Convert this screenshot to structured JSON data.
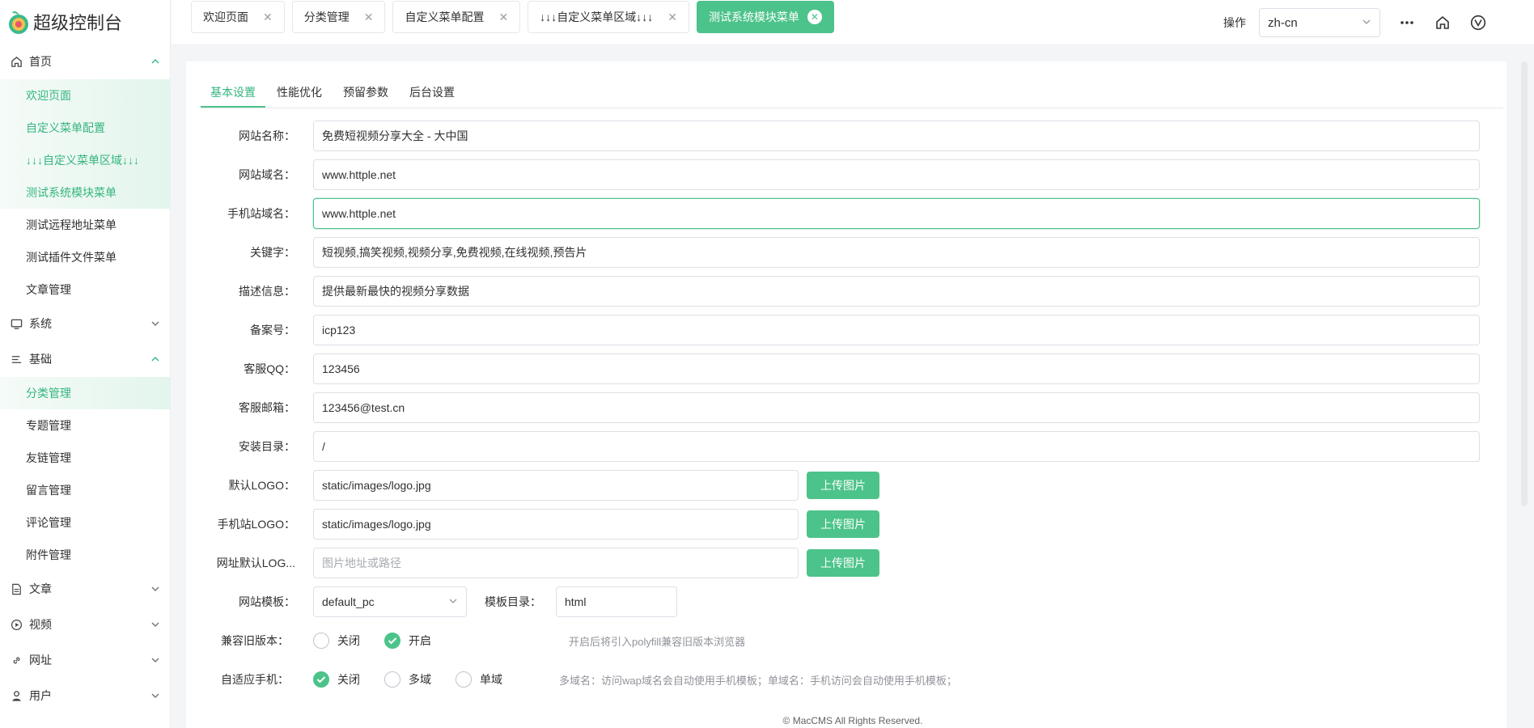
{
  "app": {
    "title": "超级控制台"
  },
  "sidebar": {
    "groups": [
      {
        "label": "首页",
        "icon": "home-icon",
        "open": true,
        "items": [
          {
            "label": "欢迎页面",
            "active": true
          },
          {
            "label": "自定义菜单配置",
            "active": true
          },
          {
            "label": "↓↓↓自定义菜单区域↓↓↓",
            "active": true
          },
          {
            "label": "测试系统模块菜单",
            "active": true
          },
          {
            "label": "测试远程地址菜单",
            "active": false
          },
          {
            "label": "测试插件文件菜单",
            "active": false
          },
          {
            "label": "文章管理",
            "active": false
          }
        ]
      },
      {
        "label": "系统",
        "icon": "monitor-icon",
        "open": false,
        "items": []
      },
      {
        "label": "基础",
        "icon": "list-icon",
        "open": true,
        "items": [
          {
            "label": "分类管理",
            "active": true
          },
          {
            "label": "专题管理",
            "active": false
          },
          {
            "label": "友链管理",
            "active": false
          },
          {
            "label": "留言管理",
            "active": false
          },
          {
            "label": "评论管理",
            "active": false
          },
          {
            "label": "附件管理",
            "active": false
          }
        ]
      },
      {
        "label": "文章",
        "icon": "document-icon",
        "open": false,
        "items": []
      },
      {
        "label": "视频",
        "icon": "play-icon",
        "open": false,
        "items": []
      },
      {
        "label": "网址",
        "icon": "link-icon",
        "open": false,
        "items": []
      },
      {
        "label": "用户",
        "icon": "user-icon",
        "open": false,
        "items": []
      }
    ]
  },
  "tabs": [
    {
      "label": "欢迎页面",
      "active": false
    },
    {
      "label": "分类管理",
      "active": false
    },
    {
      "label": "自定义菜单配置",
      "active": false
    },
    {
      "label": "↓↓↓自定义菜单区域↓↓↓",
      "active": false
    },
    {
      "label": "测试系统模块菜单",
      "active": true
    }
  ],
  "header": {
    "op_label": "操作",
    "lang": "zh-cn"
  },
  "subtabs": [
    "基本设置",
    "性能优化",
    "预留参数",
    "后台设置"
  ],
  "form": {
    "site_name": {
      "label": "网站名称：",
      "value": "免费短视频分享大全 - 大中国"
    },
    "site_domain": {
      "label": "网站域名：",
      "value": "www.httple.net"
    },
    "mobile_domain": {
      "label": "手机站域名：",
      "value": "www.httple.net"
    },
    "keywords": {
      "label": "关键字：",
      "value": "短视频,搞笑视频,视频分享,免费视频,在线视频,预告片"
    },
    "description": {
      "label": "描述信息：",
      "value": "提供最新最快的视频分享数据"
    },
    "icp": {
      "label": "备案号：",
      "value": "icp123"
    },
    "qq": {
      "label": "客服QQ：",
      "value": "123456"
    },
    "email": {
      "label": "客服邮箱：",
      "value": "123456@test.cn"
    },
    "install_dir": {
      "label": "安装目录：",
      "value": "/"
    },
    "logo": {
      "label": "默认LOGO：",
      "value": "static/images/logo.jpg",
      "button": "上传图片"
    },
    "mobile_logo": {
      "label": "手机站LOGO：",
      "value": "static/images/logo.jpg",
      "button": "上传图片"
    },
    "url_logo": {
      "label": "网址默认LOG...",
      "placeholder": "图片地址或路径",
      "button": "上传图片"
    },
    "template": {
      "label": "网站模板：",
      "value": "default_pc"
    },
    "template_dir": {
      "label": "模板目录：",
      "value": "html"
    },
    "compat": {
      "label": "兼容旧版本：",
      "options": [
        "关闭",
        "开启"
      ],
      "selected": 1,
      "hint": "开启后将引入polyfill兼容旧版本浏览器"
    },
    "adaptive": {
      "label": "自适应手机：",
      "options": [
        "关闭",
        "多域",
        "单域"
      ],
      "selected": 0,
      "hint": "多域名：访问wap域名会自动使用手机模板；单域名：手机访问会自动使用手机模板；"
    }
  },
  "footer": "© MacCMS All Rights Reserved."
}
